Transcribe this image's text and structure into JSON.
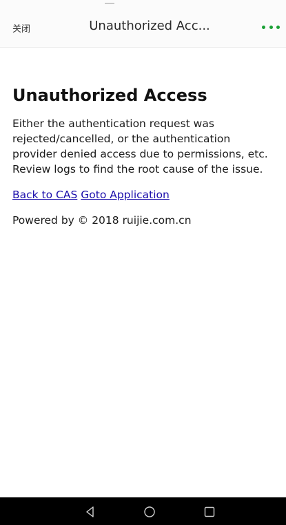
{
  "header": {
    "close_label": "关闭",
    "title": "Unauthorized Acc...",
    "more_icon": "more-dots-icon",
    "accent_color": "#1aa035"
  },
  "main": {
    "title": "Unauthorized Access",
    "description": "Either the authentication request was rejected/cancelled, or the authentication provider denied access due to permissions, etc. Review logs to find the root cause of the issue.",
    "links": {
      "back_to_cas": "Back to CAS",
      "goto_application": "Goto Application"
    },
    "powered_by": "Powered by © 2018 ruijie.com.cn",
    "link_color": "#1a0dab"
  },
  "system_nav": {
    "back_icon": "back-triangle-icon",
    "home_icon": "home-circle-icon",
    "recent_icon": "recent-apps-square-icon"
  }
}
